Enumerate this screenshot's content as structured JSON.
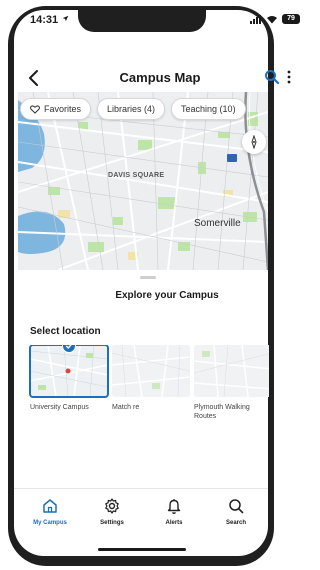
{
  "status_bar": {
    "time": "14:31",
    "battery": "79"
  },
  "header": {
    "title": "Campus Map"
  },
  "map": {
    "chips": [
      {
        "label": "Favorites",
        "icon": "heart-outline-icon"
      },
      {
        "label": "Libraries (4)"
      },
      {
        "label": "Teaching (10)"
      }
    ],
    "labels": {
      "davis_square": "DAVIS SQUARE",
      "somerville": "Somerville",
      "small": ""
    }
  },
  "sheet": {
    "title": "Explore your Campus",
    "select_heading": "Select location",
    "locations": [
      {
        "label": "University Campus",
        "selected": true
      },
      {
        "label": "Match re",
        "selected": false
      },
      {
        "label": "Plymouth Walking Routes",
        "selected": false
      }
    ]
  },
  "tabs": [
    {
      "label": "My Campus",
      "icon": "home-icon",
      "active": true
    },
    {
      "label": "Settings",
      "icon": "gear-icon",
      "active": false
    },
    {
      "label": "Alerts",
      "icon": "bell-icon",
      "active": false
    },
    {
      "label": "Search",
      "icon": "search-icon",
      "active": false
    }
  ],
  "colors": {
    "accent": "#1b6fc0",
    "map_water": "#7eb6e0",
    "map_park": "#bde6a6"
  }
}
